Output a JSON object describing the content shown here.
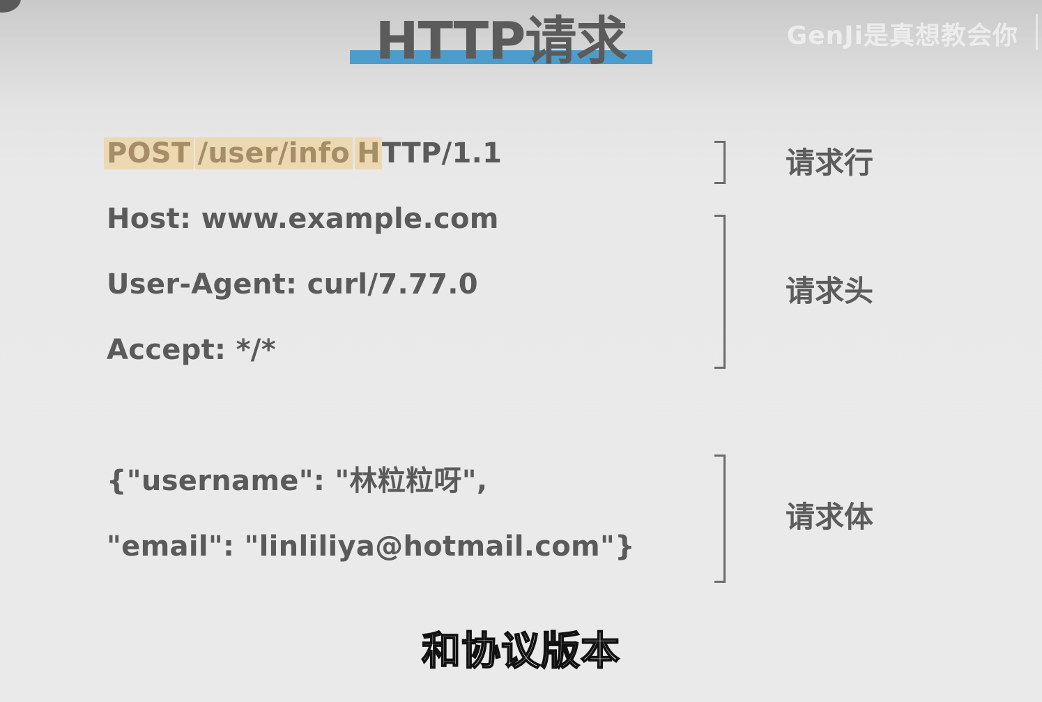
{
  "title": "HTTP请求",
  "watermark": "GenJi是真想教会你",
  "request_line": {
    "method": "POST",
    "path": "/user/info",
    "version_first_char": "H",
    "version_rest": "TTP/1.1"
  },
  "headers": [
    "Host: www.example.com",
    "User-Agent: curl/7.77.0",
    "Accept: */*"
  ],
  "body_lines": [
    "{\"username\": \"林粒粒呀\",",
    "\"email\": \"linliliya@hotmail.com\"}"
  ],
  "labels": {
    "request_line": "请求行",
    "request_headers": "请求头",
    "request_body": "请求体"
  },
  "subtitle": "和协议版本",
  "colors": {
    "title_underline": "#4e9ccb",
    "highlight": "#ecd9b2",
    "text": "#5a5a5a"
  }
}
